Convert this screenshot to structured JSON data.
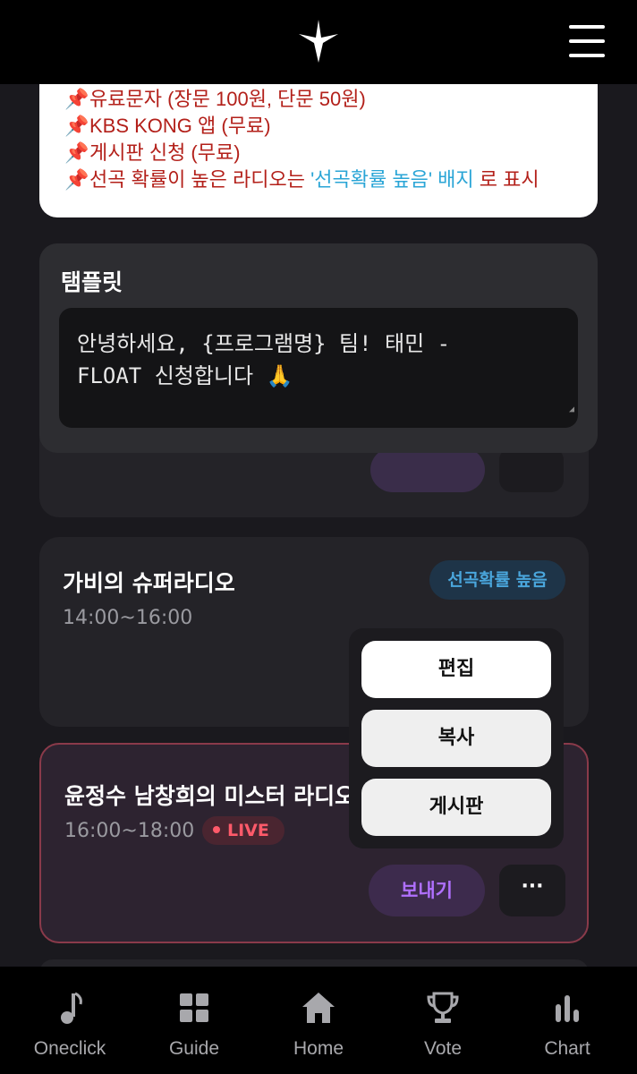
{
  "header": {
    "logo": "star-logo-icon",
    "menu": "hamburger-menu-icon"
  },
  "info": {
    "lines": [
      "유료문자 (장문 100원, 단문 50원)",
      "KBS KONG 앱 (무료)",
      "게시판 신청 (무료)"
    ],
    "last_prefix": "선곡 확률이 높은 라디오는 ",
    "last_highlight": "'선곡확률 높음' 배지",
    "last_suffix": " 로 표시",
    "pin_icon": "pushpin-icon"
  },
  "template": {
    "title": "탬플릿",
    "text_line1": "안녕하세요, {프로그램명} 팀! 태민 -",
    "text_line2": "FLOAT 신청합니다 🙏"
  },
  "radios": [
    {
      "name": "가비의 슈퍼라디오",
      "time": "14:00~16:00",
      "badge": "선곡확률 높음"
    },
    {
      "name": "윤정수 남창희의 미스터 라디오",
      "time": "16:00~18:00",
      "live": "LIVE",
      "send": "보내기",
      "more": "···"
    }
  ],
  "menu": {
    "edit": "편집",
    "copy": "복사",
    "board": "게시판"
  },
  "nav": [
    {
      "label": "Oneclick",
      "icon": "music-note-icon"
    },
    {
      "label": "Guide",
      "icon": "grid-icon"
    },
    {
      "label": "Home",
      "icon": "home-icon"
    },
    {
      "label": "Vote",
      "icon": "trophy-icon"
    },
    {
      "label": "Chart",
      "icon": "bar-chart-icon"
    }
  ],
  "colors": {
    "accent_purple": "#b070ff",
    "live_red": "#ff5a6a",
    "badge_blue": "#4aa6dc",
    "info_red": "#b3201a"
  }
}
